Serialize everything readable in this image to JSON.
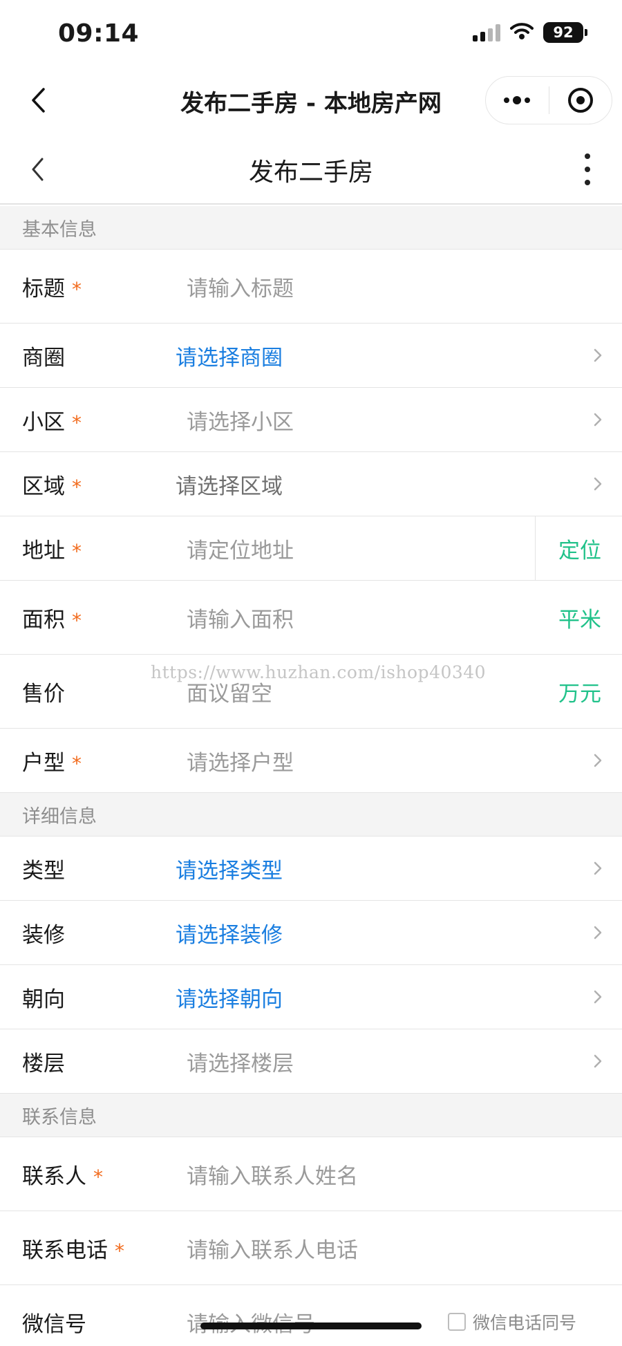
{
  "status_bar": {
    "time": "09:14",
    "battery": "92"
  },
  "mp_nav": {
    "title": "发布二手房 - 本地房产网"
  },
  "page": {
    "title": "发布二手房"
  },
  "sections": {
    "basic": "基本信息",
    "detail": "详细信息",
    "contact": "联系信息"
  },
  "fields": {
    "title": {
      "label": "标题",
      "placeholder": "请输入标题",
      "required": "*"
    },
    "business_area": {
      "label": "商圈",
      "value": "请选择商圈"
    },
    "community": {
      "label": "小区",
      "placeholder": "请选择小区",
      "required": "*"
    },
    "region": {
      "label": "区域",
      "value": "请选择区域",
      "required": "*"
    },
    "address": {
      "label": "地址",
      "placeholder": "请定位地址",
      "required": "*",
      "action": "定位"
    },
    "area": {
      "label": "面积",
      "placeholder": "请输入面积",
      "required": "*",
      "unit": "平米"
    },
    "price": {
      "label": "售价",
      "placeholder": "面议留空",
      "unit": "万元"
    },
    "layout": {
      "label": "户型",
      "placeholder": "请选择户型",
      "required": "*"
    },
    "type": {
      "label": "类型",
      "value": "请选择类型"
    },
    "decoration": {
      "label": "装修",
      "value": "请选择装修"
    },
    "orientation": {
      "label": "朝向",
      "value": "请选择朝向"
    },
    "floor": {
      "label": "楼层",
      "placeholder": "请选择楼层"
    },
    "contact_name": {
      "label": "联系人",
      "placeholder": "请输入联系人姓名",
      "required": "*"
    },
    "contact_phone": {
      "label": "联系电话",
      "placeholder": "请输入联系人电话",
      "required": "*"
    },
    "wechat": {
      "label": "微信号",
      "placeholder": "请输入微信号",
      "same_as_phone": "微信电话同号"
    }
  },
  "watermark": "https://www.huzhan.com/ishop40340",
  "colors": {
    "accent_blue": "#1a7ee0",
    "accent_green": "#21c28a",
    "required": "#f26b1d"
  },
  "icons": [
    "back-icon",
    "more-dots-icon",
    "target-icon",
    "chevron-right-icon",
    "wifi-icon",
    "signal-icon",
    "battery-icon",
    "checkbox-icon"
  ]
}
